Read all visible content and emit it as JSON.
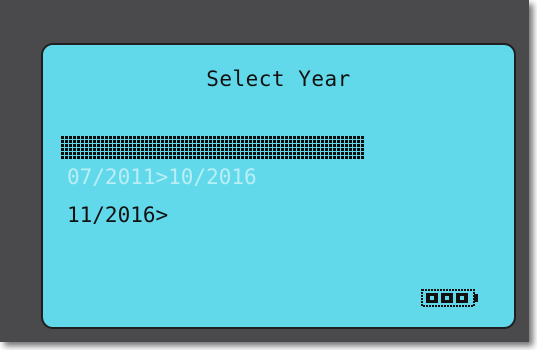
{
  "screen": {
    "title": "Select Year",
    "options": [
      {
        "label": "07/2011>10/2016",
        "selected": true
      },
      {
        "label": "11/2016>",
        "selected": false
      }
    ]
  },
  "status": {
    "battery_icon": "battery-full-icon",
    "battery_level": 1.0
  },
  "colors": {
    "lcd_background": "#62d9ea",
    "bezel": "#4a4a4c",
    "text": "#111111",
    "highlight": "#0c0c0c"
  }
}
